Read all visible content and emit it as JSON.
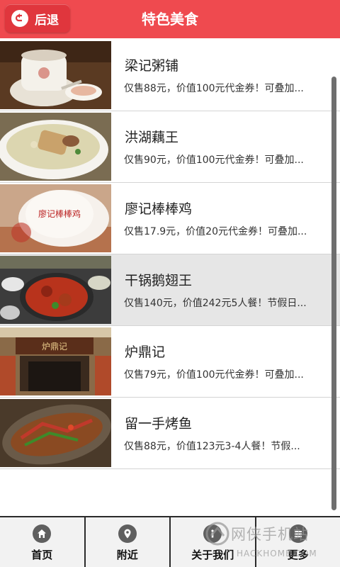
{
  "header": {
    "back_label": "后退",
    "title": "特色美食"
  },
  "items": [
    {
      "name": "梁记粥铺",
      "desc": "仅售88元，价值100元代金券！可叠加..."
    },
    {
      "name": "洪湖藕王",
      "desc": "仅售90元，价值100元代金券！可叠加..."
    },
    {
      "name": "廖记棒棒鸡",
      "desc": "仅售17.9元，价值20元代金券！可叠加..."
    },
    {
      "name": "干锅鹅翅王",
      "desc": "仅售140元，价值242元5人餐！节假日..."
    },
    {
      "name": "炉鼎记",
      "desc": "仅售79元，价值100元代金券！可叠加..."
    },
    {
      "name": "留一手烤鱼",
      "desc": "仅售88元，价值123元3-4人餐！节假..."
    }
  ],
  "tabbar": {
    "home": "首页",
    "nearby": "附近",
    "about": "关于我们",
    "more": "更多"
  },
  "watermark": {
    "text": "网侠手机站",
    "sub": "HACKHOME.COM"
  }
}
